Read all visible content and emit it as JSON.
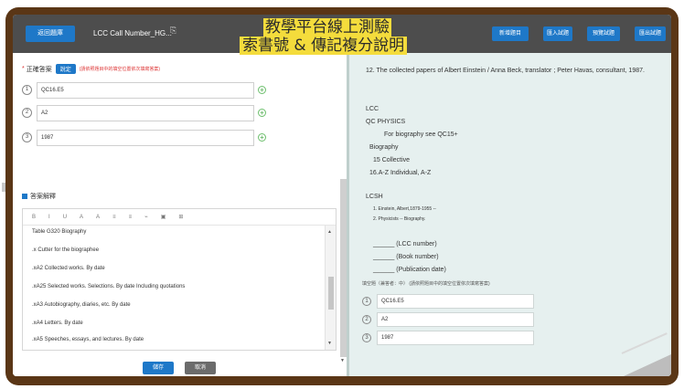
{
  "topbar": {
    "back_label": "返回題庫",
    "title": "LCC Call Number_HG...",
    "title_icon": "⎘",
    "buttons": [
      "新增題目",
      "匯入試題",
      "預覽試題",
      "匯出試題"
    ]
  },
  "overlay": {
    "line1": "教學平台線上測驗",
    "line2": "索書號 & 傳記複分說明"
  },
  "answer": {
    "label": "正確答案",
    "pill": "說定",
    "hint": "(請依照題目中的填空位置依次填寫答案)",
    "rows": [
      {
        "num": "1",
        "value": "QC16.E5"
      },
      {
        "num": "2",
        "value": "A2"
      },
      {
        "num": "3",
        "value": "1987"
      }
    ]
  },
  "explanation": {
    "label": "答案解釋",
    "toolbar": [
      "B",
      "I",
      "U",
      "A",
      "A",
      "≡",
      "≡",
      "⌁",
      "▣",
      "⊞"
    ],
    "lines": [
      "Table  G320  Biography",
      ".x Cutter for the biographee",
      ".xA2 Collected works. By date",
      ".xA25 Selected works. Selections. By date        Including quotations",
      ".xA3 Autobiography, diaries, etc. By date",
      ".xA4 Letters. By date",
      ".xA5 Speeches, essays, and lectures. By date"
    ]
  },
  "actions": {
    "save": "儲存",
    "cancel": "取消"
  },
  "question": {
    "text": "12.  The collected papers of Albert Einstein / Anna Beck, translator ; Peter Havas, consultant, 1987.",
    "lcc_heading": "LCC",
    "lcc_qc": "QC    PHYSICS",
    "lcc_see": "For biography see QC15+",
    "lcc_bio": "Biography",
    "lcc_15": "15     Collective",
    "lcc_16": "16.A-Z      Individual, A-Z",
    "lcsh_heading": "LCSH",
    "lcsh_1": "1. Einstein, Albert,1879-1955 --",
    "lcsh_2": "2. Physicists -- Biography.",
    "blank_1": "______  (LCC number)",
    "blank_2": "______  (Book number)",
    "blank_3": "______  (Publication date)",
    "fill_label": "填空題（兼答者：中）  (請依照題目中的填空位置依次填寫答案)",
    "rows": [
      {
        "num": "1",
        "value": "QC16.E5"
      },
      {
        "num": "2",
        "value": "A2"
      },
      {
        "num": "3",
        "value": "1987"
      }
    ]
  }
}
